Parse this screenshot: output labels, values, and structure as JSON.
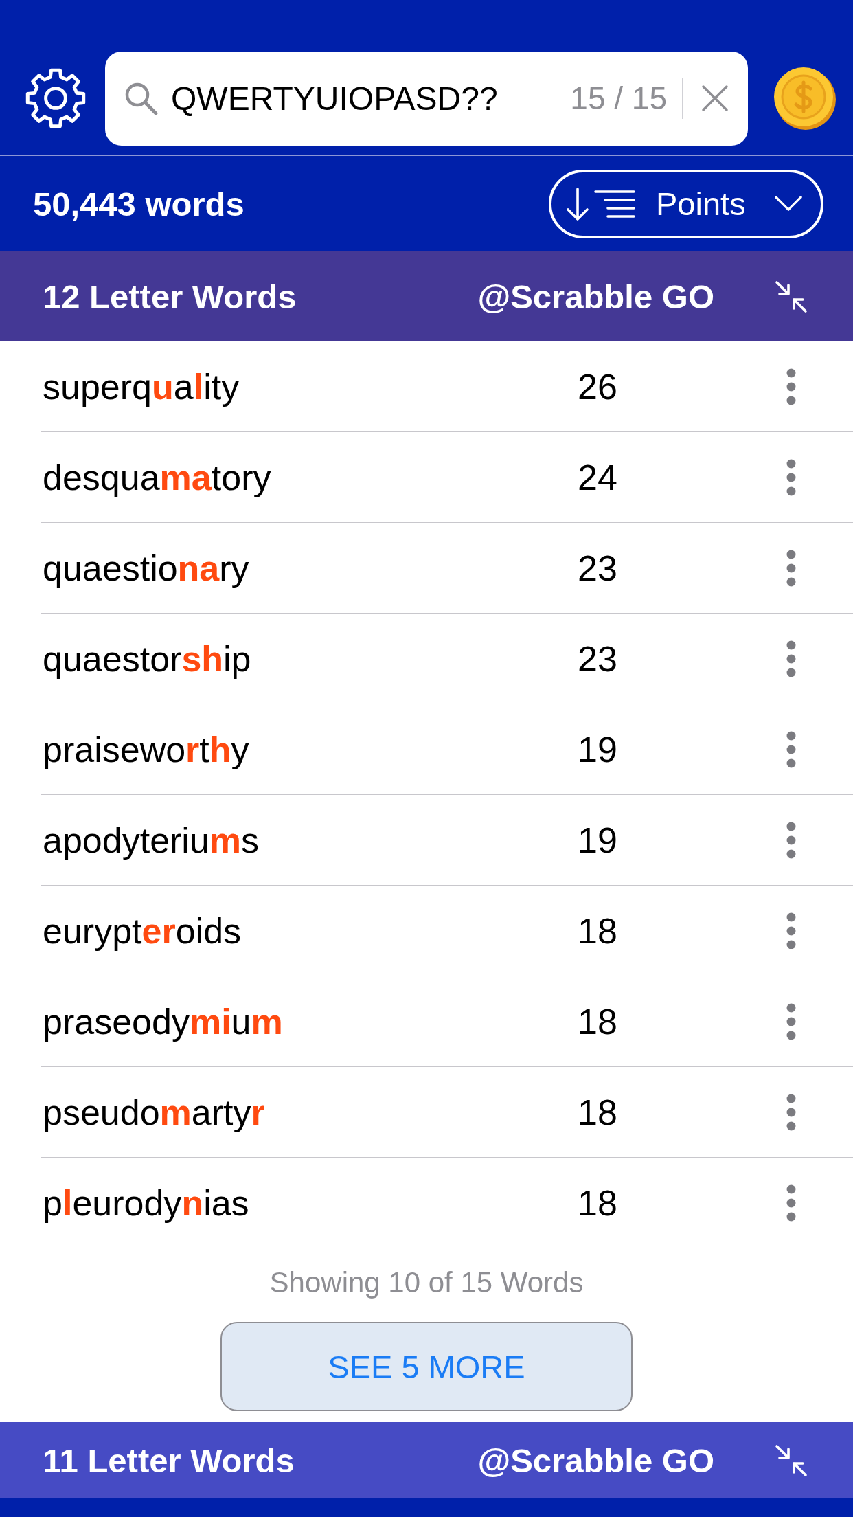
{
  "toolbar": {
    "search": {
      "value": "QWERTYUIOPASD??",
      "count": "15 / 15"
    }
  },
  "summary": {
    "word_count": "50,443 words",
    "sort": {
      "label": "Points"
    }
  },
  "sections": [
    {
      "title": "12 Letter Words",
      "source": "@Scrabble GO",
      "color": "#443895",
      "rows": [
        {
          "word": "superq**u**a**l**ity",
          "points": "26"
        },
        {
          "word": "desqua**ma**tory",
          "points": "24"
        },
        {
          "word": "quaestio**na**ry",
          "points": "23"
        },
        {
          "word": "quaestor**sh**ip",
          "points": "23"
        },
        {
          "word": "praisewo**r**t**h**y",
          "points": "19"
        },
        {
          "word": "apodyteriu**m**s",
          "points": "19"
        },
        {
          "word": "eurypt**er**oids",
          "points": "18"
        },
        {
          "word": "praseody**mi**u**m**",
          "points": "18"
        },
        {
          "word": "pseudo**m**arty**r**",
          "points": "18"
        },
        {
          "word": "p**l**eurody**n**ias",
          "points": "18"
        }
      ],
      "footer": "Showing 10 of 15 Words",
      "more_button": "SEE 5 MORE"
    },
    {
      "title": "11 Letter Words",
      "source": "@Scrabble GO",
      "color": "#464bc4"
    }
  ]
}
